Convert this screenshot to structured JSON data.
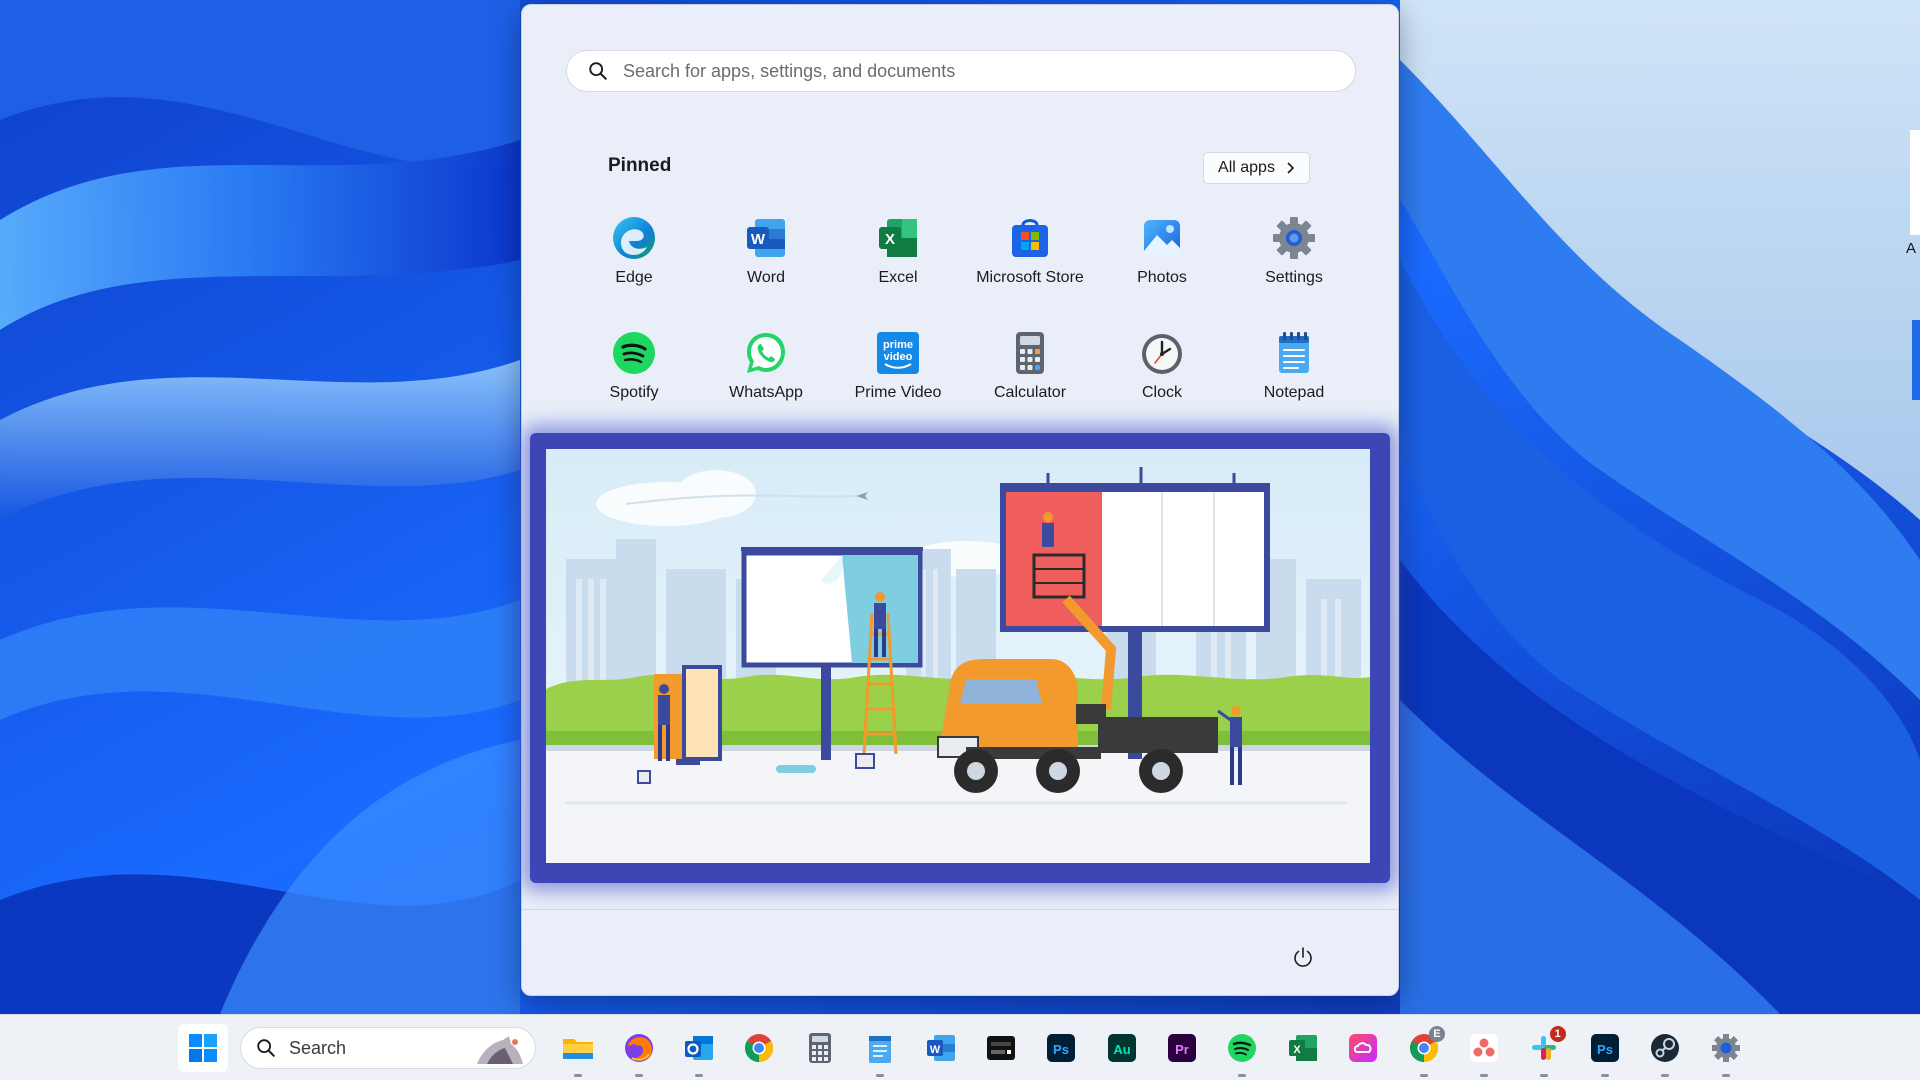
{
  "start_menu": {
    "search_placeholder": "Search for apps, settings, and documents",
    "pinned_label": "Pinned",
    "all_apps_label": "All apps",
    "pinned_apps": [
      {
        "label": "Edge",
        "icon": "edge-icon"
      },
      {
        "label": "Word",
        "icon": "word-icon"
      },
      {
        "label": "Excel",
        "icon": "excel-icon"
      },
      {
        "label": "Microsoft Store",
        "icon": "store-icon"
      },
      {
        "label": "Photos",
        "icon": "photos-icon"
      },
      {
        "label": "Settings",
        "icon": "settings-icon"
      },
      {
        "label": "Spotify",
        "icon": "spotify-icon"
      },
      {
        "label": "WhatsApp",
        "icon": "whatsapp-icon"
      },
      {
        "label": "Prime Video",
        "icon": "prime-video-icon"
      },
      {
        "label": "Calculator",
        "icon": "calculator-icon"
      },
      {
        "label": "Clock",
        "icon": "clock-icon"
      },
      {
        "label": "Notepad",
        "icon": "notepad-icon"
      }
    ],
    "banner": {
      "icon": "billboard-illustration"
    },
    "power_icon": "power-icon"
  },
  "right_edge": {
    "text": "A"
  },
  "taskbar": {
    "start_icon": "windows-logo-icon",
    "search_label": "Search",
    "apps": [
      {
        "icon": "file-explorer-icon",
        "running": true
      },
      {
        "icon": "firefox-icon",
        "running": true
      },
      {
        "icon": "outlook-icon",
        "running": true
      },
      {
        "icon": "chrome-icon",
        "running": false
      },
      {
        "icon": "calculator-icon",
        "running": false
      },
      {
        "icon": "notepad-icon",
        "running": true
      },
      {
        "icon": "word-icon",
        "running": false
      },
      {
        "icon": "capcut-icon",
        "running": false
      },
      {
        "icon": "photoshop-icon",
        "running": false
      },
      {
        "icon": "audition-icon",
        "running": false
      },
      {
        "icon": "premiere-pro-icon",
        "running": false
      },
      {
        "icon": "spotify-icon",
        "running": true
      },
      {
        "icon": "excel-icon",
        "running": false
      },
      {
        "icon": "creative-cloud-icon",
        "running": false
      },
      {
        "icon": "chrome-profile-icon",
        "running": true,
        "badge": "E"
      },
      {
        "icon": "asana-icon",
        "running": true
      },
      {
        "icon": "slack-icon",
        "running": true,
        "badge": "1"
      },
      {
        "icon": "photoshop-icon",
        "running": true
      },
      {
        "icon": "steam-icon",
        "running": true
      },
      {
        "icon": "settings-icon",
        "running": true
      }
    ]
  },
  "colors": {
    "wallpaper": "#1652d8",
    "start_menu_bg": "#e9eef8",
    "banner_frame": "#3d46b5",
    "accent": "#0078d4"
  }
}
